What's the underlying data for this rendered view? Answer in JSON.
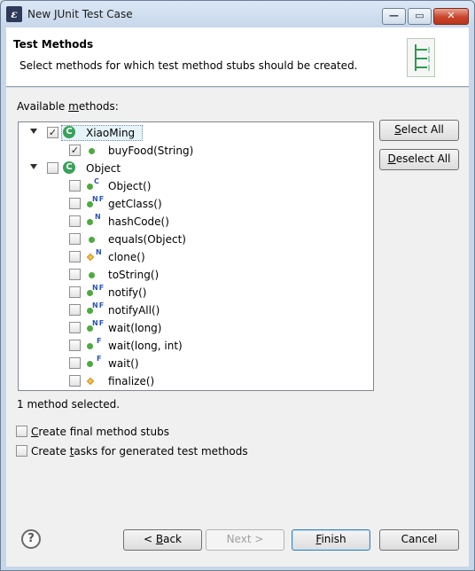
{
  "window": {
    "title": "New JUnit Test Case",
    "minimize": "—",
    "maximize": "▭",
    "close": "✕"
  },
  "banner": {
    "title": "Test Methods",
    "description": "Select methods for which test method stubs should be created."
  },
  "available": {
    "pre": "Available ",
    "key": "m",
    "post": "ethods:"
  },
  "tree": {
    "xiaoming": {
      "label": "XiaoMing",
      "checked": true,
      "expanded": true,
      "selected": true,
      "methods": [
        {
          "label": "buyFood(String)",
          "checked": true
        }
      ]
    },
    "object": {
      "label": "Object",
      "checked": false,
      "expanded": true,
      "methods": [
        {
          "label": "Object()",
          "badge": "C",
          "icon": "green-dot-icon"
        },
        {
          "label": "getClass()",
          "badge": "NF",
          "icon": "green-dot-icon"
        },
        {
          "label": "hashCode()",
          "badge": "N",
          "icon": "green-dot-icon"
        },
        {
          "label": "equals(Object)",
          "badge": "",
          "icon": "green-dot-icon"
        },
        {
          "label": "clone()",
          "badge": "N",
          "icon": "yellow-diamond-icon"
        },
        {
          "label": "toString()",
          "badge": "",
          "icon": "green-dot-icon"
        },
        {
          "label": "notify()",
          "badge": "NF",
          "icon": "green-dot-icon"
        },
        {
          "label": "notifyAll()",
          "badge": "NF",
          "icon": "green-dot-icon"
        },
        {
          "label": "wait(long)",
          "badge": "NF",
          "icon": "green-dot-icon"
        },
        {
          "label": "wait(long, int)",
          "badge": "F",
          "icon": "green-dot-icon"
        },
        {
          "label": "wait()",
          "badge": "F",
          "icon": "green-dot-icon"
        },
        {
          "label": "finalize()",
          "badge": "",
          "icon": "yellow-diamond-icon"
        }
      ]
    }
  },
  "buttons": {
    "select_all": {
      "key": "S",
      "rest": "elect All"
    },
    "deselect_all": {
      "key": "D",
      "rest": "eselect All"
    },
    "back": {
      "pre": "< ",
      "key": "B",
      "rest": "ack"
    },
    "next": "Next >",
    "finish": {
      "key": "F",
      "rest": "inish"
    },
    "cancel": "Cancel"
  },
  "status": "1 method selected.",
  "options": [
    {
      "key": "C",
      "rest": "reate final method stubs",
      "checked": false
    },
    {
      "pre": "Create ",
      "key": "t",
      "rest": "asks for generated test methods",
      "checked": false
    }
  ],
  "help": "?",
  "colors": {
    "method_public": "#4fa93f",
    "method_protected": "#f3c24a",
    "class_icon": "#3aa15a"
  }
}
